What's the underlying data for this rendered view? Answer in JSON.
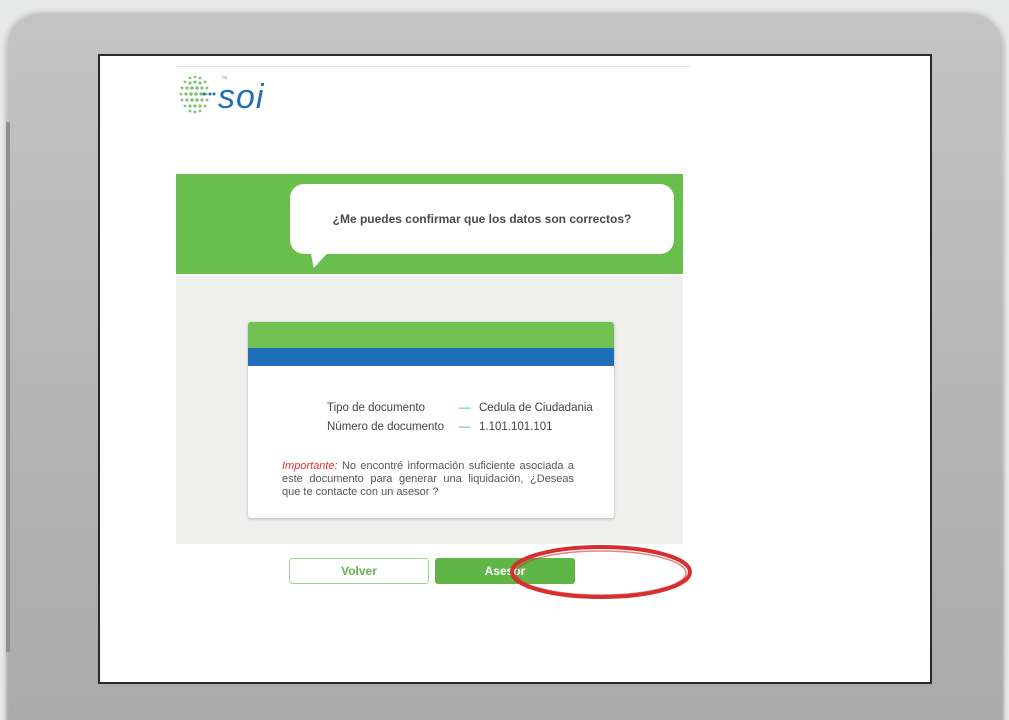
{
  "logo": {
    "text": "soi",
    "small_text": "mi"
  },
  "bubble": {
    "question": "¿Me puedes confirmar que los datos son correctos?"
  },
  "document": {
    "type_label": "Tipo de documento",
    "type_value": "Cedula de Ciudadania",
    "number_label": "Número de documento",
    "number_value": "1.101.101.101",
    "separator": "—"
  },
  "notice": {
    "lead": "Importante:",
    "text": " No encontré información suficiente asociada a este documento para generar una liquidación, ¿Deseas que te contacte con un asesor ?"
  },
  "buttons": {
    "back_label": "Volver",
    "advisor_label": "Asesor"
  },
  "colors": {
    "brand_green": "#68bf4c",
    "brand_blue": "#1f6fb8",
    "highlight_red": "#d62f2f",
    "important_red": "#e3322b"
  }
}
